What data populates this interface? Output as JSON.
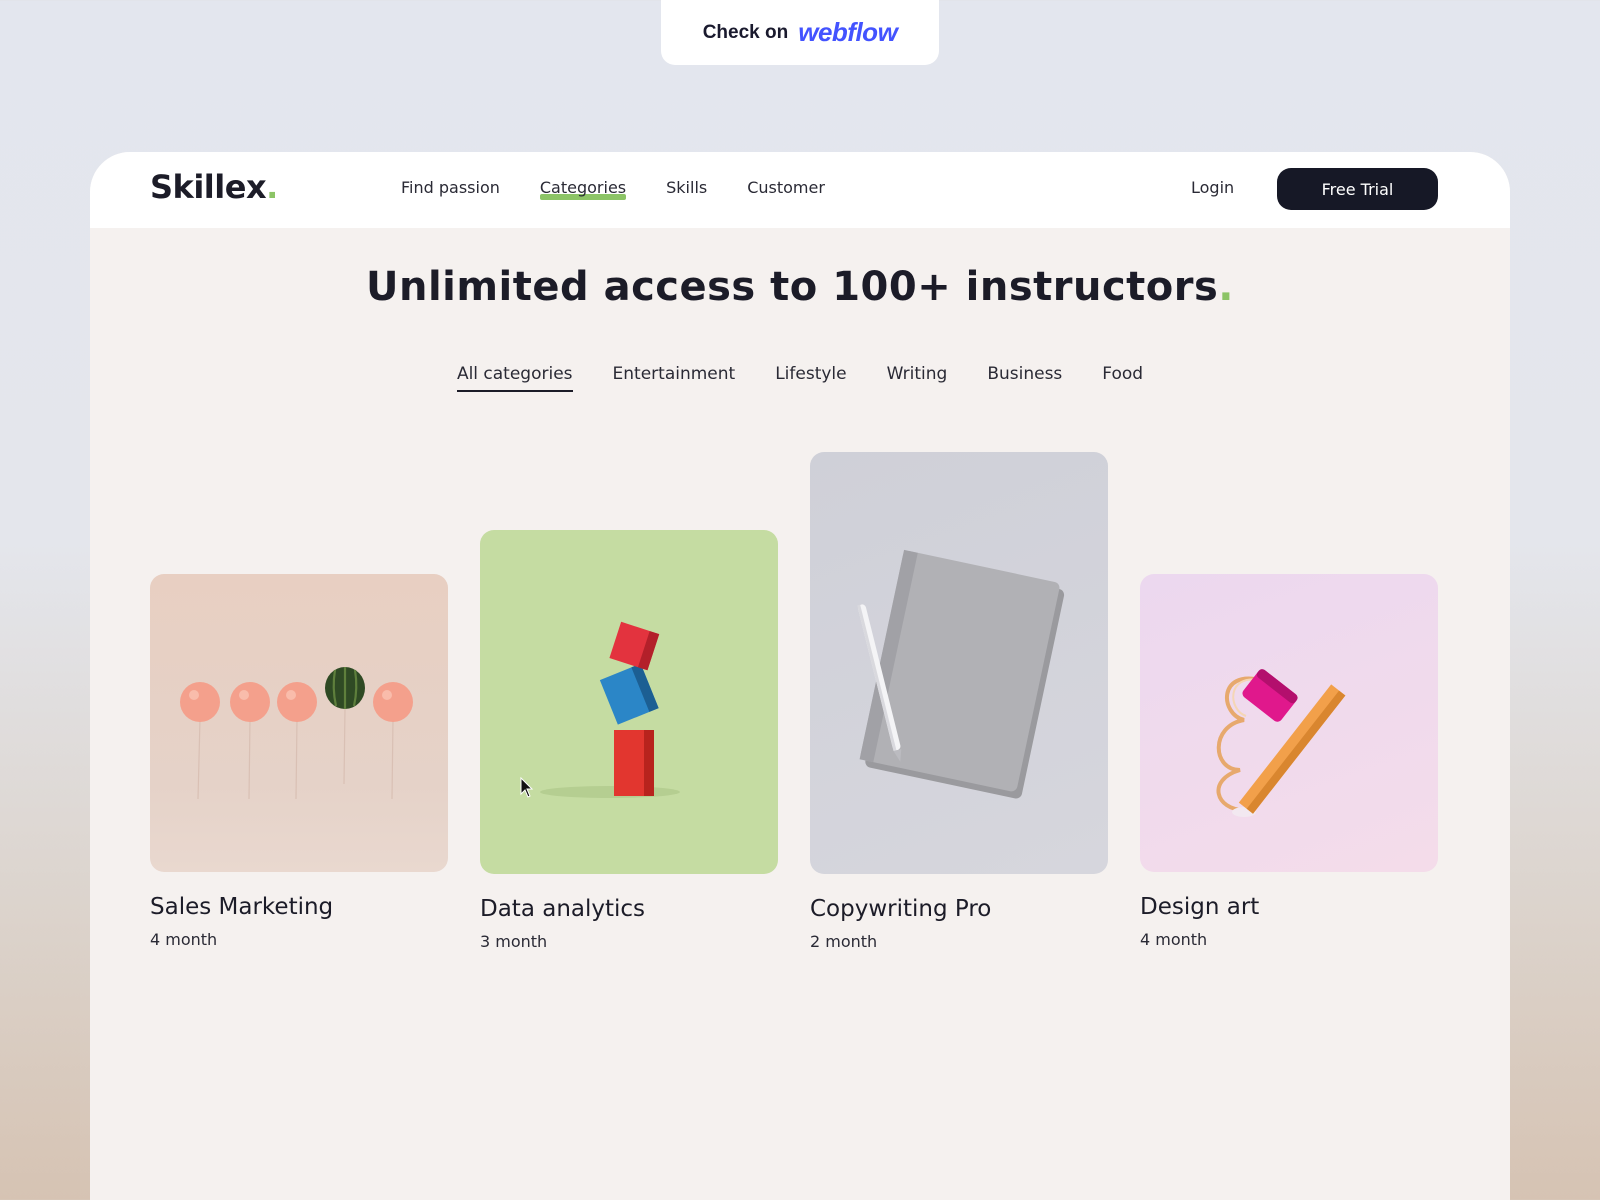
{
  "badge": {
    "label": "Check on",
    "brand": "webflow"
  },
  "nav": {
    "logo": "Skillex",
    "logo_dot": ".",
    "links": [
      "Find passion",
      "Categories",
      "Skills",
      "Customer"
    ],
    "active_link": "Categories",
    "login": "Login",
    "cta": "Free Trial"
  },
  "hero": {
    "headline": "Unlimited access to 100+ instructors",
    "headline_dot": "."
  },
  "tabs": {
    "items": [
      "All categories",
      "Entertainment",
      "Lifestyle",
      "Writing",
      "Business",
      "Food"
    ],
    "active": "All categories"
  },
  "courses": [
    {
      "title": "Sales Marketing",
      "duration": "4 month",
      "image": "balloons-watermelon-image"
    },
    {
      "title": "Data analytics",
      "duration": "3 month",
      "image": "stacked-blocks-image"
    },
    {
      "title": "Copywriting Pro",
      "duration": "2 month",
      "image": "notebook-pen-image"
    },
    {
      "title": "Design art",
      "duration": "4 month",
      "image": "pencil-sharpener-image"
    }
  ],
  "colors": {
    "accent_green": "#8cc466",
    "dark": "#161826",
    "webflow_blue": "#4353ff"
  }
}
